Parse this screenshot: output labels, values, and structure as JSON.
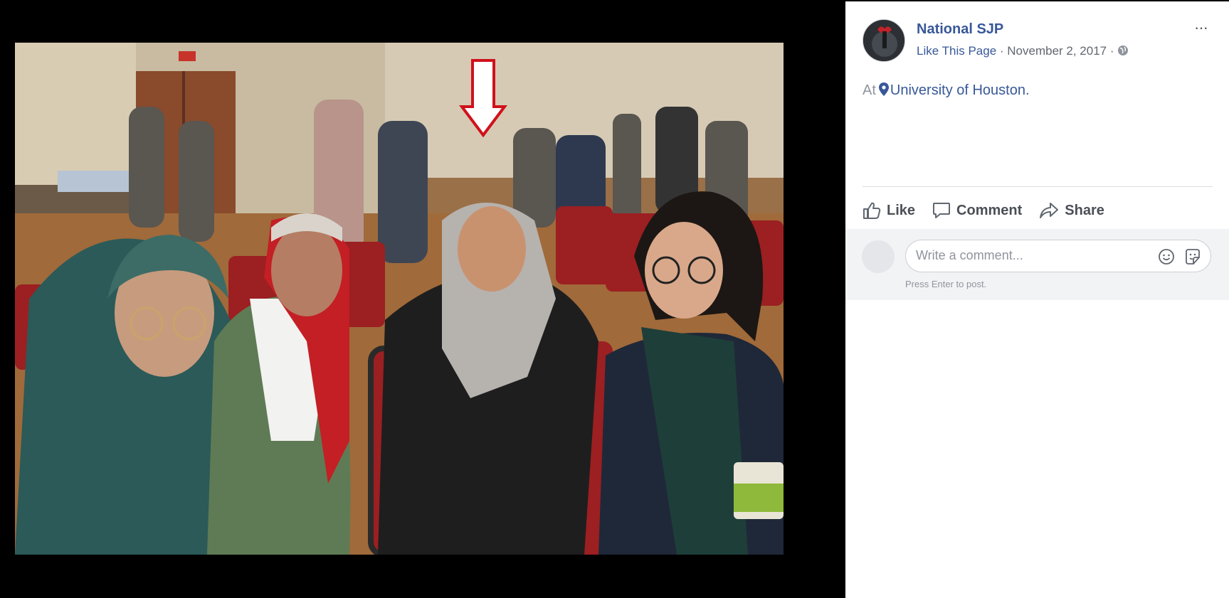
{
  "post": {
    "page_name": "National SJP",
    "like_page": "Like This Page",
    "separator": " · ",
    "date": "November 2, 2017",
    "more_label": "···",
    "privacy_icon": "globe-icon",
    "location_prefix": "At",
    "location": "University of Houston",
    "location_suffix": ".",
    "location_icon": "map-pin-icon"
  },
  "actions": {
    "like": "Like",
    "comment": "Comment",
    "share": "Share"
  },
  "comment": {
    "placeholder": "Write a comment...",
    "hint": "Press Enter to post.",
    "emoji_icon": "emoji-icon",
    "sticker_icon": "sticker-icon"
  },
  "colors": {
    "link": "#385898",
    "muted": "#616770",
    "annotation_arrow": "#d0111b"
  }
}
